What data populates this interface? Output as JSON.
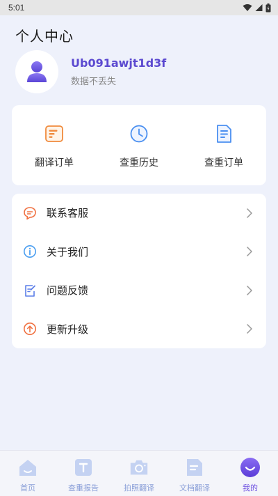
{
  "status_bar": {
    "time": "5:01"
  },
  "page": {
    "title": "个人中心"
  },
  "profile": {
    "username": "Ub091awjt1d3f",
    "subtitle": "数据不丢失"
  },
  "shortcuts": [
    {
      "label": "翻译订单",
      "icon": "order-icon"
    },
    {
      "label": "查重历史",
      "icon": "clock-icon"
    },
    {
      "label": "查重订单",
      "icon": "document-icon"
    }
  ],
  "menu": [
    {
      "label": "联系客服",
      "icon": "chat-icon"
    },
    {
      "label": "关于我们",
      "icon": "info-icon"
    },
    {
      "label": "问题反馈",
      "icon": "feedback-icon"
    },
    {
      "label": "更新升级",
      "icon": "upgrade-icon"
    }
  ],
  "tabs": [
    {
      "label": "首页",
      "icon": "home-icon",
      "active": false
    },
    {
      "label": "查重报告",
      "icon": "report-icon",
      "active": false
    },
    {
      "label": "拍照翻译",
      "icon": "camera-icon",
      "active": false
    },
    {
      "label": "文档翻译",
      "icon": "file-icon",
      "active": false
    },
    {
      "label": "我的",
      "icon": "profile-icon",
      "active": true
    }
  ],
  "colors": {
    "accent": "#5b49d0",
    "page_bg": "#eef1fb",
    "orange": "#f08a3c",
    "blue": "#4a8ff0",
    "tab_inactive": "#8a9fd8",
    "tab_active": "#6a4de0"
  }
}
